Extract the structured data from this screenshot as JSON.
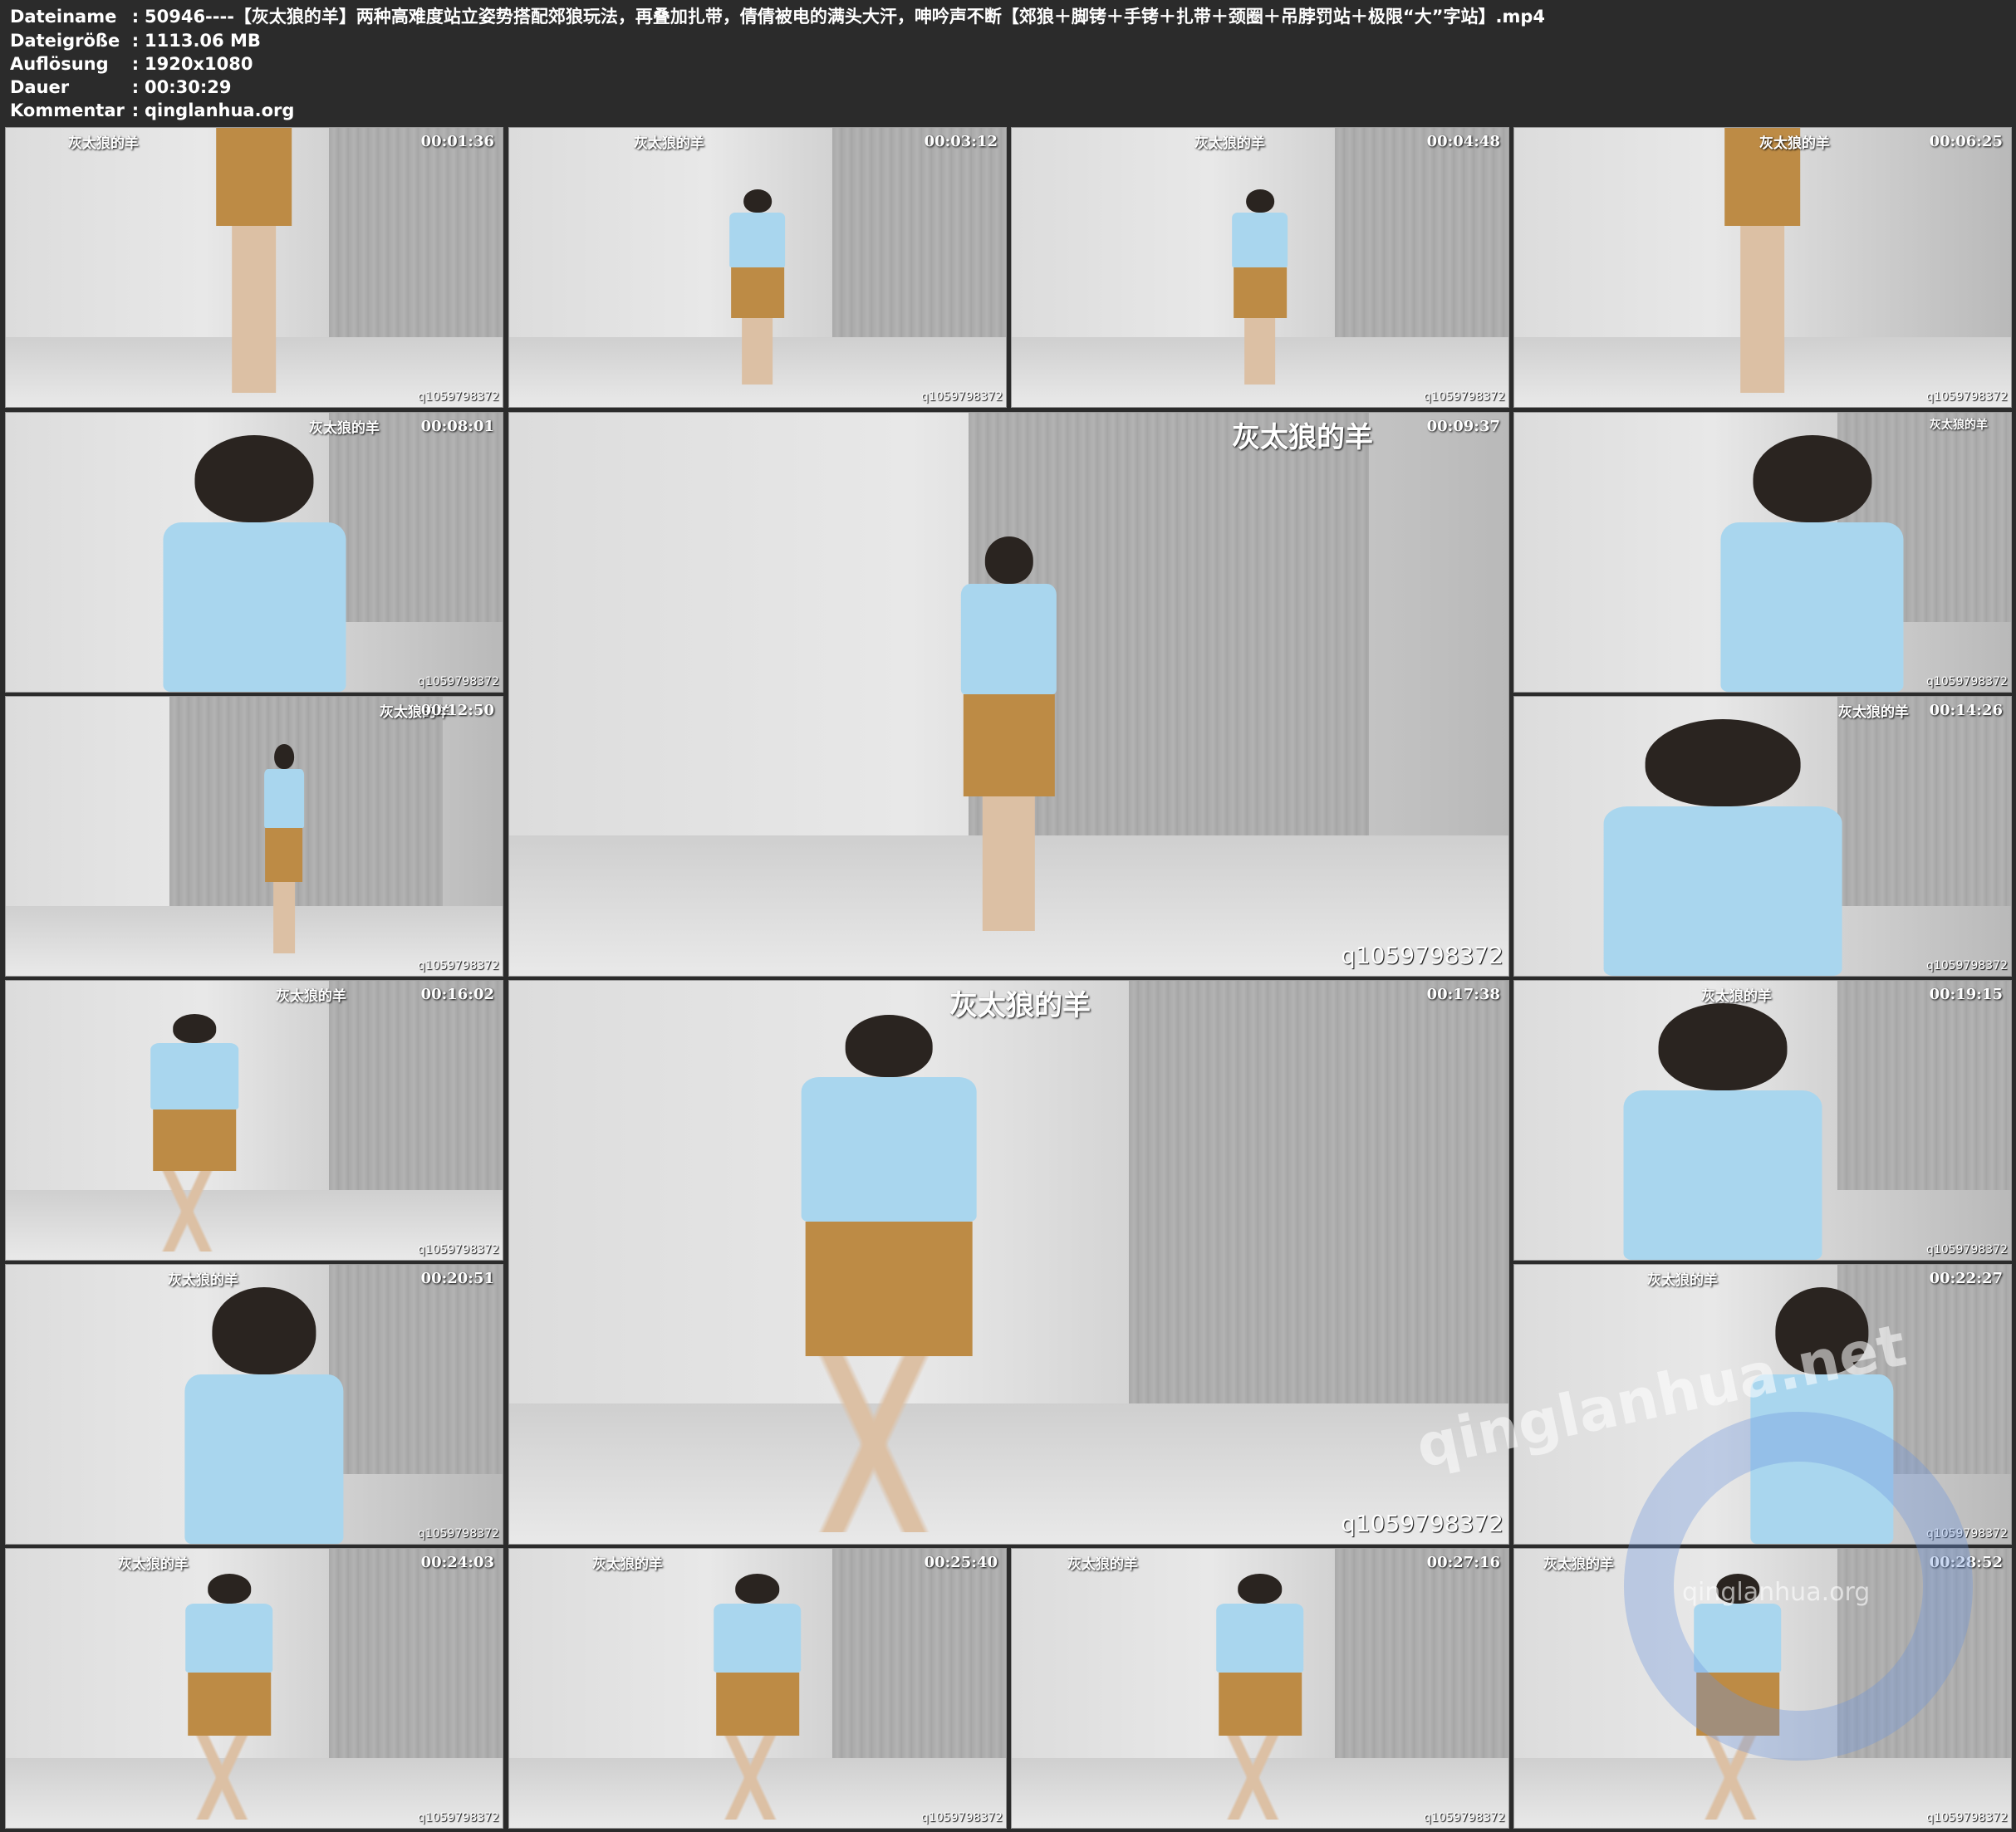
{
  "header": {
    "rows": [
      {
        "key": "Dateiname",
        "value": "50946----【灰太狼的羊】两种高难度站立姿势搭配郊狼玩法，再叠加扎带，倩倩被电的满头大汗，呻吟声不断【郊狼＋脚铐＋手铐＋扎带＋颈圈＋吊脖罚站＋极限“大”字站】.mp4"
      },
      {
        "key": "Dateigröße",
        "value": "1113.06 MB"
      },
      {
        "key": "Auflösung",
        "value": "1920x1080"
      },
      {
        "key": "Dauer",
        "value": "00:30:29"
      },
      {
        "key": "Kommentar",
        "value": "qinglanhua.org"
      }
    ],
    "separator": ":"
  },
  "thumbs": [
    {
      "time": "00:01:36",
      "wm": "灰太狼的羊",
      "qq": "q1059798372"
    },
    {
      "time": "00:03:12",
      "wm": "灰太狼的羊",
      "qq": "q1059798372"
    },
    {
      "time": "00:04:48",
      "wm": "灰太狼的羊",
      "qq": "q1059798372"
    },
    {
      "time": "00:06:25",
      "wm": "灰太狼的羊",
      "qq": "q1059798372"
    },
    {
      "time": "00:08:01",
      "wm": "灰太狼的羊",
      "qq": "q1059798372"
    },
    {
      "time": "00:09:37",
      "wm": "灰太狼的羊",
      "qq": "q1059798372"
    },
    {
      "time": "",
      "wm": "灰太狼的羊",
      "qq": "q1059798372"
    },
    {
      "time": "00:12:50",
      "wm": "灰太狼的羊",
      "qq": "q1059798372"
    },
    {
      "time": "00:14:26",
      "wm": "灰太狼的羊",
      "qq": "q1059798372"
    },
    {
      "time": "00:16:02",
      "wm": "灰太狼的羊",
      "qq": "q1059798372"
    },
    {
      "time": "00:17:38",
      "wm": "灰太狼的羊",
      "qq": "q1059798372"
    },
    {
      "time": "00:19:15",
      "wm": "灰太狼的羊",
      "qq": "q1059798372"
    },
    {
      "time": "00:20:51",
      "wm": "灰太狼的羊",
      "qq": "q1059798372"
    },
    {
      "time": "00:22:27",
      "wm": "灰太狼的羊",
      "qq": "q1059798372"
    },
    {
      "time": "00:24:03",
      "wm": "灰太狼的羊",
      "qq": "q1059798372"
    },
    {
      "time": "00:25:40",
      "wm": "灰太狼的羊",
      "qq": "q1059798372"
    },
    {
      "time": "00:27:16",
      "wm": "灰太狼的羊",
      "qq": "q1059798372"
    },
    {
      "time": "00:28:52",
      "wm": "灰太狼的羊",
      "qq": "q1059798372"
    }
  ],
  "site_watermark": "qinglanhua.net",
  "site_watermark_small": "qinglanhua.org"
}
